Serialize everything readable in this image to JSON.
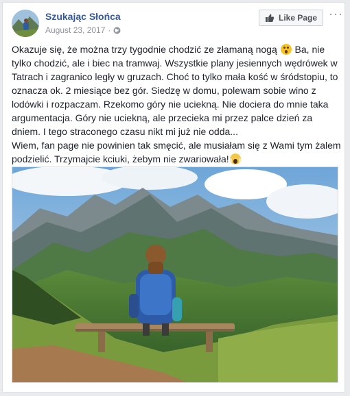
{
  "post": {
    "page_name": "Szukając Słońca",
    "date": "August 23, 2017",
    "meta_separator": "·",
    "like_page_label": "Like Page",
    "more_label": "···",
    "text": {
      "p1_a": "Okazuje się, że można trzy tygodnie chodzić ze złamaną nogą",
      "p1_b": "Ba, nie tylko chodzić, ale i biec na tramwaj. Wszystkie plany jesiennych wędrówek w Tatrach i zagranico legły w gruzach. Choć to tylko mała kość w śródstopiu, to oznacza ok. 2 miesiące bez gór. Siedzę w domu, polewam sobie wino z lodówki i rozpaczam. Rzekomo góry nie uciekną. Nie dociera do mnie taka argumentacja. Góry nie uciekną, ale przecieka mi przez palce dzień za dniem. I tego straconego czasu nikt mi już nie odda...",
      "p2": "Wiem, fan page nie powinien tak smęcić, ale musiałam się z Wami tym żalem podzielić. Trzymajcie kciuki, żebym nie zwariowała!"
    },
    "emojis": [
      "surprised-face",
      "screaming-face"
    ],
    "icons": [
      "avatar-photo",
      "globe-icon",
      "thumbs-up-icon",
      "more-icon"
    ],
    "photo": "woman with backpack sitting on a wooden bench facing Tatra mountains"
  },
  "colors": {
    "page_name": "#365899",
    "meta": "#90949c",
    "text": "#1d2129",
    "background": "#e9ebee"
  }
}
